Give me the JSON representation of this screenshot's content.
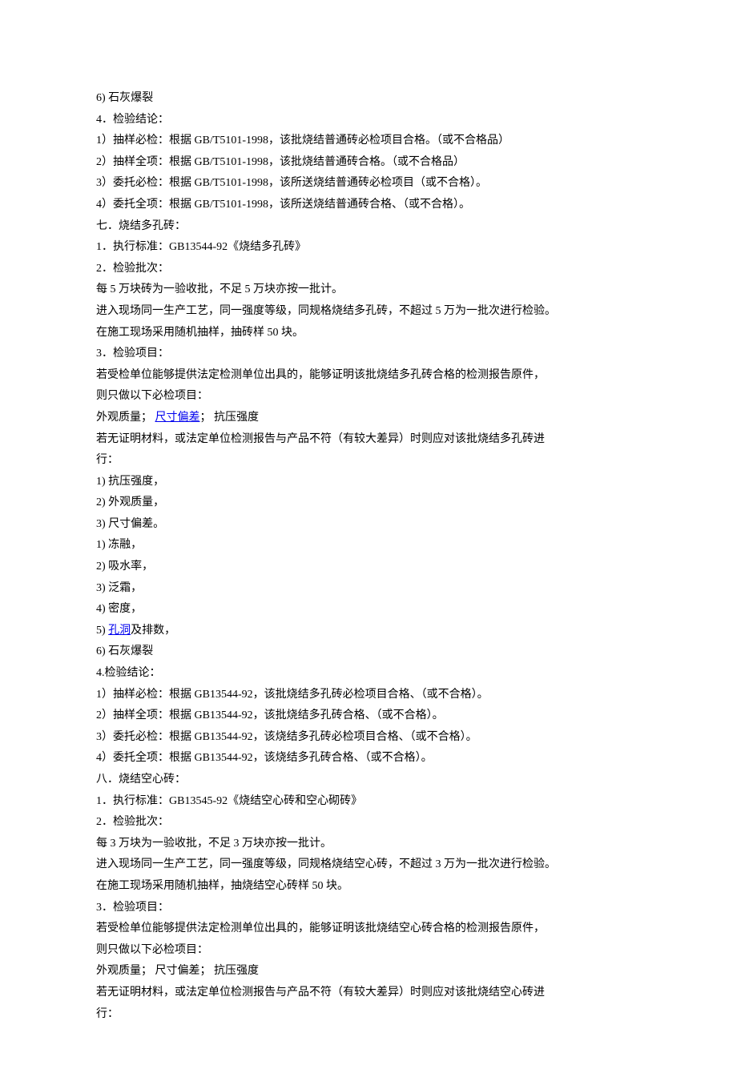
{
  "lines": [
    {
      "segments": [
        {
          "t": "6) 石灰爆裂"
        }
      ]
    },
    {
      "segments": [
        {
          "t": "4．检验结论："
        }
      ]
    },
    {
      "segments": [
        {
          "t": "1）抽样必检：根据 GB/T5101-1998，该批烧结普通砖必检项目合格。（或不合格品）"
        }
      ]
    },
    {
      "segments": [
        {
          "t": "2）抽样全项：根据 GB/T5101-1998，该批烧结普通砖合格。（或不合格品）"
        }
      ]
    },
    {
      "segments": [
        {
          "t": "3）委托必检：根据 GB/T5101-1998，该所送烧结普通砖必检项目（或不合格）。"
        }
      ]
    },
    {
      "segments": [
        {
          "t": "4）委托全项：根据 GB/T5101-1998，该所送烧结普通砖合格、（或不合格）。"
        }
      ]
    },
    {
      "segments": [
        {
          "t": "七．烧结多孔砖："
        }
      ]
    },
    {
      "segments": [
        {
          "t": "1．执行标准：GB13544-92《烧结多孔砖》"
        }
      ]
    },
    {
      "segments": [
        {
          "t": "2．检验批次："
        }
      ]
    },
    {
      "segments": [
        {
          "t": "每 5 万块砖为一验收批，不足 5 万块亦按一批计。"
        }
      ]
    },
    {
      "segments": [
        {
          "t": "进入现场同一生产工艺，同一强度等级，同规格烧结多孔砖，不超过 5 万为一批次进行检验。"
        }
      ]
    },
    {
      "segments": [
        {
          "t": "在施工现场采用随机抽样，抽砖样 50 块。"
        }
      ]
    },
    {
      "segments": [
        {
          "t": "3．检验项目："
        }
      ]
    },
    {
      "segments": [
        {
          "t": "若受检单位能够提供法定检测单位出具的，能够证明该批烧结多孔砖合格的检测报告原件，"
        }
      ]
    },
    {
      "segments": [
        {
          "t": "则只做以下必检项目："
        }
      ]
    },
    {
      "segments": [
        {
          "t": "外观质量； "
        },
        {
          "t": "尺寸偏差",
          "link": true
        },
        {
          "t": "； 抗压强度"
        }
      ]
    },
    {
      "segments": [
        {
          "t": "若无证明材料，或法定单位检测报告与产品不符（有较大差异）时则应对该批烧结多孔砖进"
        }
      ]
    },
    {
      "segments": [
        {
          "t": "行："
        }
      ]
    },
    {
      "segments": [
        {
          "t": "1) 抗压强度，"
        }
      ]
    },
    {
      "segments": [
        {
          "t": "2) 外观质量，"
        }
      ]
    },
    {
      "segments": [
        {
          "t": "3) 尺寸偏差。"
        }
      ]
    },
    {
      "segments": [
        {
          "t": "1) 冻融，"
        }
      ]
    },
    {
      "segments": [
        {
          "t": "2) 吸水率，"
        }
      ]
    },
    {
      "segments": [
        {
          "t": "3) 泛霜，"
        }
      ]
    },
    {
      "segments": [
        {
          "t": "4) 密度，"
        }
      ]
    },
    {
      "segments": [
        {
          "t": "5) "
        },
        {
          "t": "孔洞",
          "link": true
        },
        {
          "t": "及排数，"
        }
      ]
    },
    {
      "segments": [
        {
          "t": "6) 石灰爆裂"
        }
      ]
    },
    {
      "segments": [
        {
          "t": "4.检验结论："
        }
      ]
    },
    {
      "segments": [
        {
          "t": "1）抽样必检：根据 GB13544-92，该批烧结多孔砖必检项目合格、（或不合格）。"
        }
      ]
    },
    {
      "segments": [
        {
          "t": "2）抽样全项：根据 GB13544-92，该批烧结多孔砖合格、（或不合格）。"
        }
      ]
    },
    {
      "segments": [
        {
          "t": "3）委托必检：根据 GB13544-92，该烧结多孔砖必检项目合格、（或不合格）。"
        }
      ]
    },
    {
      "segments": [
        {
          "t": "4）委托全项：根据 GB13544-92，该烧结多孔砖合格、（或不合格）。"
        }
      ]
    },
    {
      "segments": [
        {
          "t": "八．烧结空心砖："
        }
      ]
    },
    {
      "segments": [
        {
          "t": "1．执行标准：GB13545-92《烧结空心砖和空心砌砖》"
        }
      ]
    },
    {
      "segments": [
        {
          "t": "2．检验批次："
        }
      ]
    },
    {
      "segments": [
        {
          "t": "每 3 万块为一验收批，不足 3 万块亦按一批计。"
        }
      ]
    },
    {
      "segments": [
        {
          "t": "进入现场同一生产工艺，同一强度等级，同规格烧结空心砖，不超过 3 万为一批次进行检验。"
        }
      ]
    },
    {
      "segments": [
        {
          "t": "在施工现场采用随机抽样，抽烧结空心砖样 50 块。"
        }
      ]
    },
    {
      "segments": [
        {
          "t": "3．检验项目："
        }
      ]
    },
    {
      "segments": [
        {
          "t": "若受检单位能够提供法定检测单位出具的，能够证明该批烧结空心砖合格的检测报告原件，"
        }
      ]
    },
    {
      "segments": [
        {
          "t": "则只做以下必检项目："
        }
      ]
    },
    {
      "segments": [
        {
          "t": "外观质量； 尺寸偏差； 抗压强度"
        }
      ]
    },
    {
      "segments": [
        {
          "t": "若无证明材料，或法定单位检测报告与产品不符（有较大差异）时则应对该批烧结空心砖进"
        }
      ]
    },
    {
      "segments": [
        {
          "t": "行："
        }
      ]
    }
  ]
}
